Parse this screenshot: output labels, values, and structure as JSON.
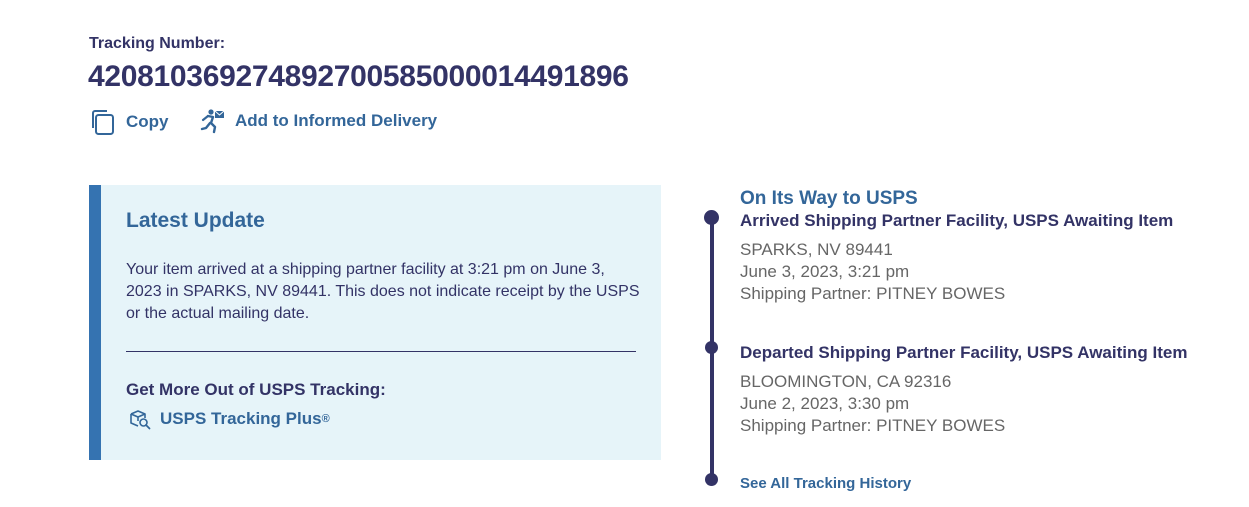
{
  "tracking": {
    "label": "Tracking Number:",
    "number": "420810369274892700585000014491896"
  },
  "actions": {
    "copy_label": "Copy",
    "informed_delivery_label": "Add to Informed Delivery"
  },
  "latest_update": {
    "title": "Latest Update",
    "text": "Your item arrived at a shipping partner facility at 3:21 pm on June 3, 2023 in SPARKS, NV 89441. This does not indicate receipt by the USPS or the actual mailing date.",
    "more_title": "Get More Out of USPS Tracking:",
    "plus_label": "USPS Tracking Plus",
    "plus_mark": "®"
  },
  "timeline": {
    "status": "On Its Way to USPS",
    "events": [
      {
        "title": "Arrived Shipping Partner Facility, USPS Awaiting Item",
        "location": "SPARKS, NV 89441",
        "datetime": "June 3, 2023, 3:21 pm",
        "partner": "Shipping Partner: PITNEY BOWES"
      },
      {
        "title": "Departed Shipping Partner Facility, USPS Awaiting Item",
        "location": "BLOOMINGTON, CA 92316",
        "datetime": "June 2, 2023, 3:30 pm",
        "partner": "Shipping Partner: PITNEY BOWES"
      }
    ],
    "history_link": "See All Tracking History"
  },
  "colors": {
    "navy": "#333366",
    "link_blue": "#336699",
    "panel_bg": "#e6f4f9",
    "accent_bar": "#3573b1",
    "gray_text": "#666666"
  },
  "icons": {
    "copy": "copy-icon",
    "informed_delivery": "mail-carrier-icon",
    "tracking_plus": "package-search-icon"
  }
}
